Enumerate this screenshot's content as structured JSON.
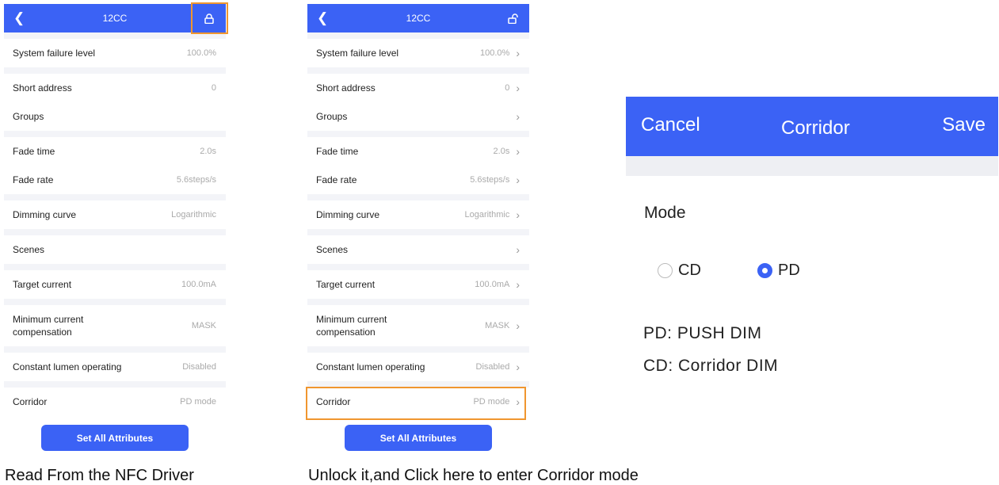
{
  "phone_left": {
    "header": {
      "back_icon": "chevron-left-icon",
      "title": "12CC",
      "lock_icon": "locked-icon"
    },
    "rows": [
      {
        "label": "System failure level",
        "value": "100.0%"
      },
      {
        "label": "Short address",
        "value": "0"
      },
      {
        "label": "Groups",
        "value": ""
      },
      {
        "label": "Fade time",
        "value": "2.0s"
      },
      {
        "label": "Fade rate",
        "value": "5.6steps/s"
      },
      {
        "label": "Dimming curve",
        "value": "Logarithmic"
      },
      {
        "label": "Scenes",
        "value": ""
      },
      {
        "label": "Target current",
        "value": "100.0mA"
      },
      {
        "label": "Minimum current compensation",
        "value": "MASK"
      },
      {
        "label": "Constant lumen operating",
        "value": "Disabled"
      },
      {
        "label": "Corridor",
        "value": "PD mode"
      }
    ],
    "button": "Set All Attributes",
    "caption": "Read From the NFC Driver"
  },
  "phone_right": {
    "header": {
      "back_icon": "chevron-left-icon",
      "title": "12CC",
      "lock_icon": "unlocked-icon"
    },
    "rows": [
      {
        "label": "System failure level",
        "value": "100.0%"
      },
      {
        "label": "Short address",
        "value": "0"
      },
      {
        "label": "Groups",
        "value": ""
      },
      {
        "label": "Fade time",
        "value": "2.0s"
      },
      {
        "label": "Fade rate",
        "value": "5.6steps/s"
      },
      {
        "label": "Dimming curve",
        "value": "Logarithmic"
      },
      {
        "label": "Scenes",
        "value": ""
      },
      {
        "label": "Target current",
        "value": "100.0mA"
      },
      {
        "label": "Minimum current compensation",
        "value": "MASK"
      },
      {
        "label": "Constant lumen operating",
        "value": "Disabled"
      },
      {
        "label": "Corridor",
        "value": "PD mode"
      }
    ],
    "button": "Set All Attributes",
    "caption": "Unlock it,and Click here to enter Corridor mode"
  },
  "corridor_panel": {
    "cancel": "Cancel",
    "title": "Corridor",
    "save": "Save",
    "mode_label": "Mode",
    "options": [
      {
        "label": "CD",
        "selected": false
      },
      {
        "label": "PD",
        "selected": true
      }
    ],
    "desc_pd": "PD:  PUSH DIM",
    "desc_cd": "CD:  Corridor DIM"
  },
  "colors": {
    "brand_blue": "#3b62f5",
    "highlight_orange": "#f0962f",
    "separator": "#f3f4f8"
  }
}
